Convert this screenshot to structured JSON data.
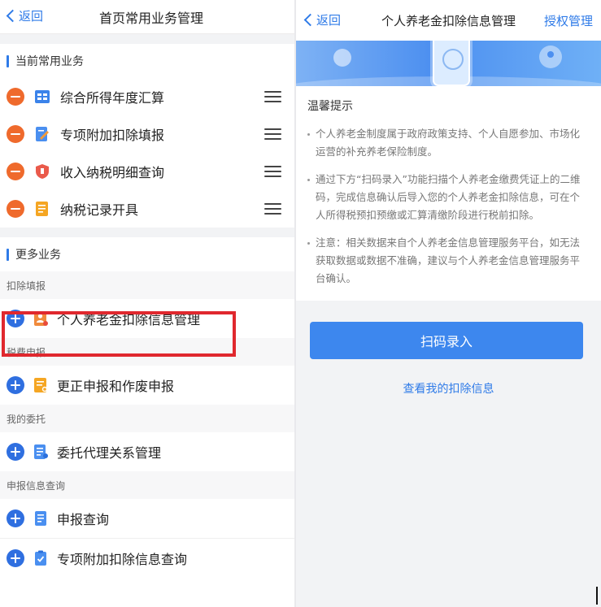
{
  "left": {
    "back_label": "返回",
    "title": "首页常用业务管理",
    "current_section": "当前常用业务",
    "current_items": [
      {
        "label": "综合所得年度汇算",
        "icon": "table-icon"
      },
      {
        "label": "专项附加扣除填报",
        "icon": "edit-document-icon"
      },
      {
        "label": "收入纳税明细查询",
        "icon": "shield-icon"
      },
      {
        "label": "纳税记录开具",
        "icon": "record-icon"
      }
    ],
    "more_section": "更多业务",
    "categories": [
      {
        "label": "扣除填报",
        "items": [
          {
            "label": "个人养老金扣除信息管理",
            "icon": "pension-icon"
          }
        ]
      },
      {
        "label": "税费申报",
        "items": [
          {
            "label": "更正申报和作废申报",
            "icon": "correction-icon"
          }
        ]
      },
      {
        "label": "我的委托",
        "items": [
          {
            "label": "委托代理关系管理",
            "icon": "proxy-icon"
          }
        ]
      },
      {
        "label": "申报信息查询",
        "items": [
          {
            "label": "申报查询",
            "icon": "document-icon"
          },
          {
            "label": "专项附加扣除信息查询",
            "icon": "deduction-query-icon"
          }
        ]
      }
    ]
  },
  "right": {
    "back_label": "返回",
    "title": "个人养老金扣除信息管理",
    "auth_link": "授权管理",
    "tips_title": "温馨提示",
    "tips": [
      "个人养老金制度属于政府政策支持、个人自愿参加、市场化运营的补充养老保险制度。",
      "通过下方“扫码录入”功能扫描个人养老金缴费凭证上的二维码，完成信息确认后导入您的个人养老金扣除信息，可在个人所得税预扣预缴或汇算清缴阶段进行税前扣除。",
      "注意：相关数据来自个人养老金信息管理服务平台，如无法获取数据或数据不准确，建议与个人养老金信息管理服务平台确认。"
    ],
    "scan_button": "扫码录入",
    "view_link": "查看我的扣除信息"
  },
  "colors": {
    "accent": "#2f7be8",
    "remove": "#ef6a2c",
    "add": "#2f6fe0",
    "highlight_border": "#e0282e",
    "primary_button": "#3d87ee"
  }
}
